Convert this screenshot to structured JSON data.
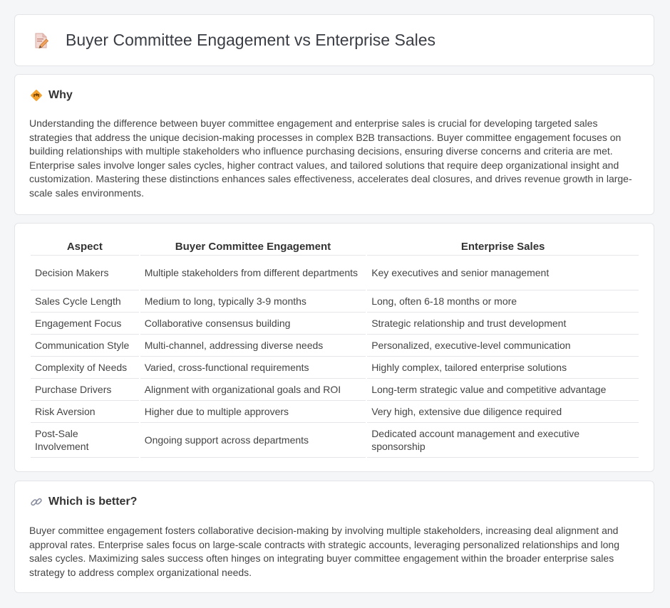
{
  "header": {
    "title": "Buyer Committee Engagement vs Enterprise Sales",
    "icon": "document-edit-icon"
  },
  "why": {
    "icon": "diamond-directions-icon",
    "title": "Why",
    "text": "Understanding the difference between buyer committee engagement and enterprise sales is crucial for developing targeted sales strategies that address the unique decision-making processes in complex B2B transactions. Buyer committee engagement focuses on building relationships with multiple stakeholders who influence purchasing decisions, ensuring diverse concerns and criteria are met. Enterprise sales involve longer sales cycles, higher contract values, and tailored solutions that require deep organizational insight and customization. Mastering these distinctions enhances sales effectiveness, accelerates deal closures, and drives revenue growth in large-scale sales environments."
  },
  "table": {
    "headers": [
      "Aspect",
      "Buyer Committee Engagement",
      "Enterprise Sales"
    ],
    "rows": [
      [
        "Decision Makers",
        "Multiple stakeholders from different departments",
        "Key executives and senior management"
      ],
      [
        "Sales Cycle Length",
        "Medium to long, typically 3-9 months",
        "Long, often 6-18 months or more"
      ],
      [
        "Engagement Focus",
        "Collaborative consensus building",
        "Strategic relationship and trust development"
      ],
      [
        "Communication Style",
        "Multi-channel, addressing diverse needs",
        "Personalized, executive-level communication"
      ],
      [
        "Complexity of Needs",
        "Varied, cross-functional requirements",
        "Highly complex, tailored enterprise solutions"
      ],
      [
        "Purchase Drivers",
        "Alignment with organizational goals and ROI",
        "Long-term strategic value and competitive advantage"
      ],
      [
        "Risk Aversion",
        "Higher due to multiple approvers",
        "Very high, extensive due diligence required"
      ],
      [
        "Post-Sale Involvement",
        "Ongoing support across departments",
        "Dedicated account management and executive sponsorship"
      ]
    ]
  },
  "better": {
    "icon": "link-icon",
    "title": "Which is better?",
    "text": "Buyer committee engagement fosters collaborative decision-making by involving multiple stakeholders, increasing deal alignment and approval rates. Enterprise sales focus on large-scale contracts with strategic accounts, leveraging personalized relationships and long sales cycles. Maximizing sales success often hinges on integrating buyer committee engagement within the broader enterprise sales strategy to address complex organizational needs."
  }
}
